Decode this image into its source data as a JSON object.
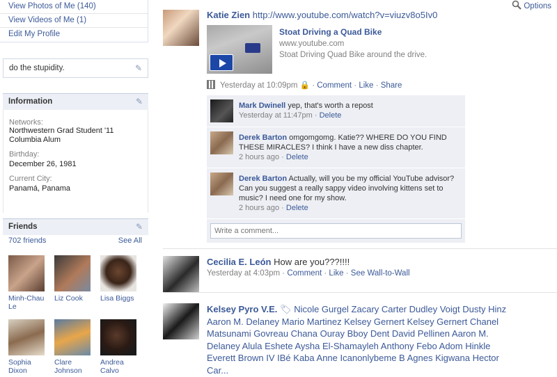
{
  "left": {
    "links": [
      "View Photos of Me (140)",
      "View Videos of Me (1)",
      "Edit My Profile"
    ],
    "bio": "do the stupidity.",
    "info": {
      "title": "Information",
      "networks_label": "Networks:",
      "networks": [
        "Northwestern Grad Student '11",
        "Columbia Alum"
      ],
      "birthday_label": "Birthday:",
      "birthday": "December 26, 1981",
      "city_label": "Current City:",
      "city": "Panamá, Panama"
    },
    "friends": {
      "title": "Friends",
      "count": "702 friends",
      "see_all": "See All",
      "list": [
        "Minh-Chau Le",
        "Liz Cook",
        "Lisa Biggs",
        "Sophia Dixon",
        "Clare Johnson",
        "Andrea Calvo"
      ]
    }
  },
  "main": {
    "options": "Options",
    "post1": {
      "actor": "Katie Zien",
      "url": "http://www.youtube.com/watch?v=viuzv8o5Iv0",
      "video_title": "Stoat Driving a Quad Bike",
      "video_domain": "www.youtube.com",
      "video_desc": "Stoat Driving Quad Bike around the drive.",
      "time": "Yesterday at 10:09pm",
      "comment": "Comment",
      "like": "Like",
      "share": "Share",
      "comments": [
        {
          "name": "Mark Dwinell",
          "text": "yep, that's worth a repost",
          "time": "Yesterday at 11:47pm",
          "action": "Delete"
        },
        {
          "name": "Derek Barton",
          "text": "omgomgomg. Katie?? WHERE DO YOU FIND THESE MIRACLES? I think I have a new diss chapter.",
          "time": "2 hours ago",
          "action": "Delete"
        },
        {
          "name": "Derek Barton",
          "text": "Actually, will you be my official YouTube advisor? Can you suggest a really sappy video involving kittens set to music? I need one for my show.",
          "time": "2 hours ago",
          "action": "Delete"
        }
      ],
      "write_placeholder": "Write a comment..."
    },
    "post2": {
      "actor": "Cecilia E. León",
      "text": "How are you???!!!!",
      "time": "Yesterday at 4:03pm",
      "comment": "Comment",
      "like": "Like",
      "wall": "See Wall-to-Wall"
    },
    "post3": {
      "actor": "Kelsey Pyro V.E.",
      "tags": "Nicole Gurgel Zacary Carter Dudley Voigt Dusty Hinz Aaron M. Delaney Mario Martinez Kelsey Gernert Kelsey Gernert Chanel Matsunami Govreau Chana Ouray Bboy Dent David Pellinen Aaron M. Delaney Alula Eshete Aysha El-Shamayleh Anthony Febo Adom Hinkle Everett Brown IV IBé Kaba Anne Icanonlybeme B Agnes Kigwana Hector Car..."
    }
  },
  "colors": {
    "link": "#3b5998",
    "section_bg": "#eceff5",
    "comment_bg": "#edeff4"
  }
}
